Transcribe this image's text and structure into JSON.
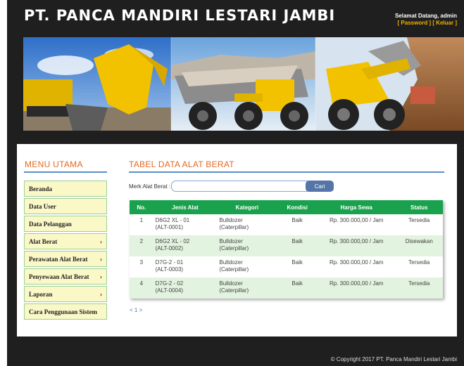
{
  "header": {
    "title": "PT. PANCA MANDIRI LESTARI JAMBI",
    "welcome": "Selamat Datang, admin",
    "password_link": "Password",
    "logout_link": "Keluar"
  },
  "sidebar": {
    "title": "MENU UTAMA",
    "items": [
      {
        "label": "Beranda",
        "has_submenu": false
      },
      {
        "label": "Data User",
        "has_submenu": false
      },
      {
        "label": "Data Pelanggan",
        "has_submenu": false
      },
      {
        "label": "Alat Berat",
        "has_submenu": true
      },
      {
        "label": "Perawatan Alat Berat",
        "has_submenu": true
      },
      {
        "label": "Penyewaan Alat Berat",
        "has_submenu": true
      },
      {
        "label": "Laporan",
        "has_submenu": true
      },
      {
        "label": "Cara Penggunaan Sistem",
        "has_submenu": false
      }
    ],
    "arrow_glyph": "›"
  },
  "main": {
    "title": "TABEL DATA ALAT BERAT",
    "search": {
      "label": "Merk Alat Berat :",
      "value": "",
      "placeholder": "",
      "button": "Cari"
    },
    "table": {
      "columns": [
        "No.",
        "Jenis Alat",
        "Kategori",
        "Kondisi",
        "Harga Sewa",
        "Status"
      ],
      "rows": [
        {
          "no": "1",
          "jenis": "D6G2 XL - 01",
          "kode": "(ALT-0001)",
          "kategori": "Bulldozer",
          "merk": "(Caterpillar)",
          "kondisi": "Baik",
          "harga": "Rp. 300.000,00 / Jam",
          "status": "Tersedia"
        },
        {
          "no": "2",
          "jenis": "D6G2 XL - 02",
          "kode": "(ALT-0002)",
          "kategori": "Bulldozer",
          "merk": "(Caterpillar)",
          "kondisi": "Baik",
          "harga": "Rp. 300.000,00 / Jam",
          "status": "Disewakan"
        },
        {
          "no": "3",
          "jenis": "D7G-2 - 01",
          "kode": "(ALT-0003)",
          "kategori": "Bulldozer",
          "merk": "(Caterpillar)",
          "kondisi": "Baik",
          "harga": "Rp. 300.000,00 / Jam",
          "status": "Tersedia"
        },
        {
          "no": "4",
          "jenis": "D7G-2 - 02",
          "kode": "(ALT-0004)",
          "kategori": "Bulldozer",
          "merk": "(Caterpillar)",
          "kondisi": "Baik",
          "harga": "Rp. 300.000,00 / Jam",
          "status": "Tersedia"
        }
      ]
    },
    "pager": "< 1 >"
  },
  "footer": {
    "copyright": "© Copyright 2017 PT. Panca Mandiri Lestari Jambi"
  },
  "colors": {
    "accent_orange": "#e36a1f",
    "table_header_green": "#1aa14e",
    "menu_bg": "#fbf8c8",
    "link_yellow": "#f0b400"
  }
}
